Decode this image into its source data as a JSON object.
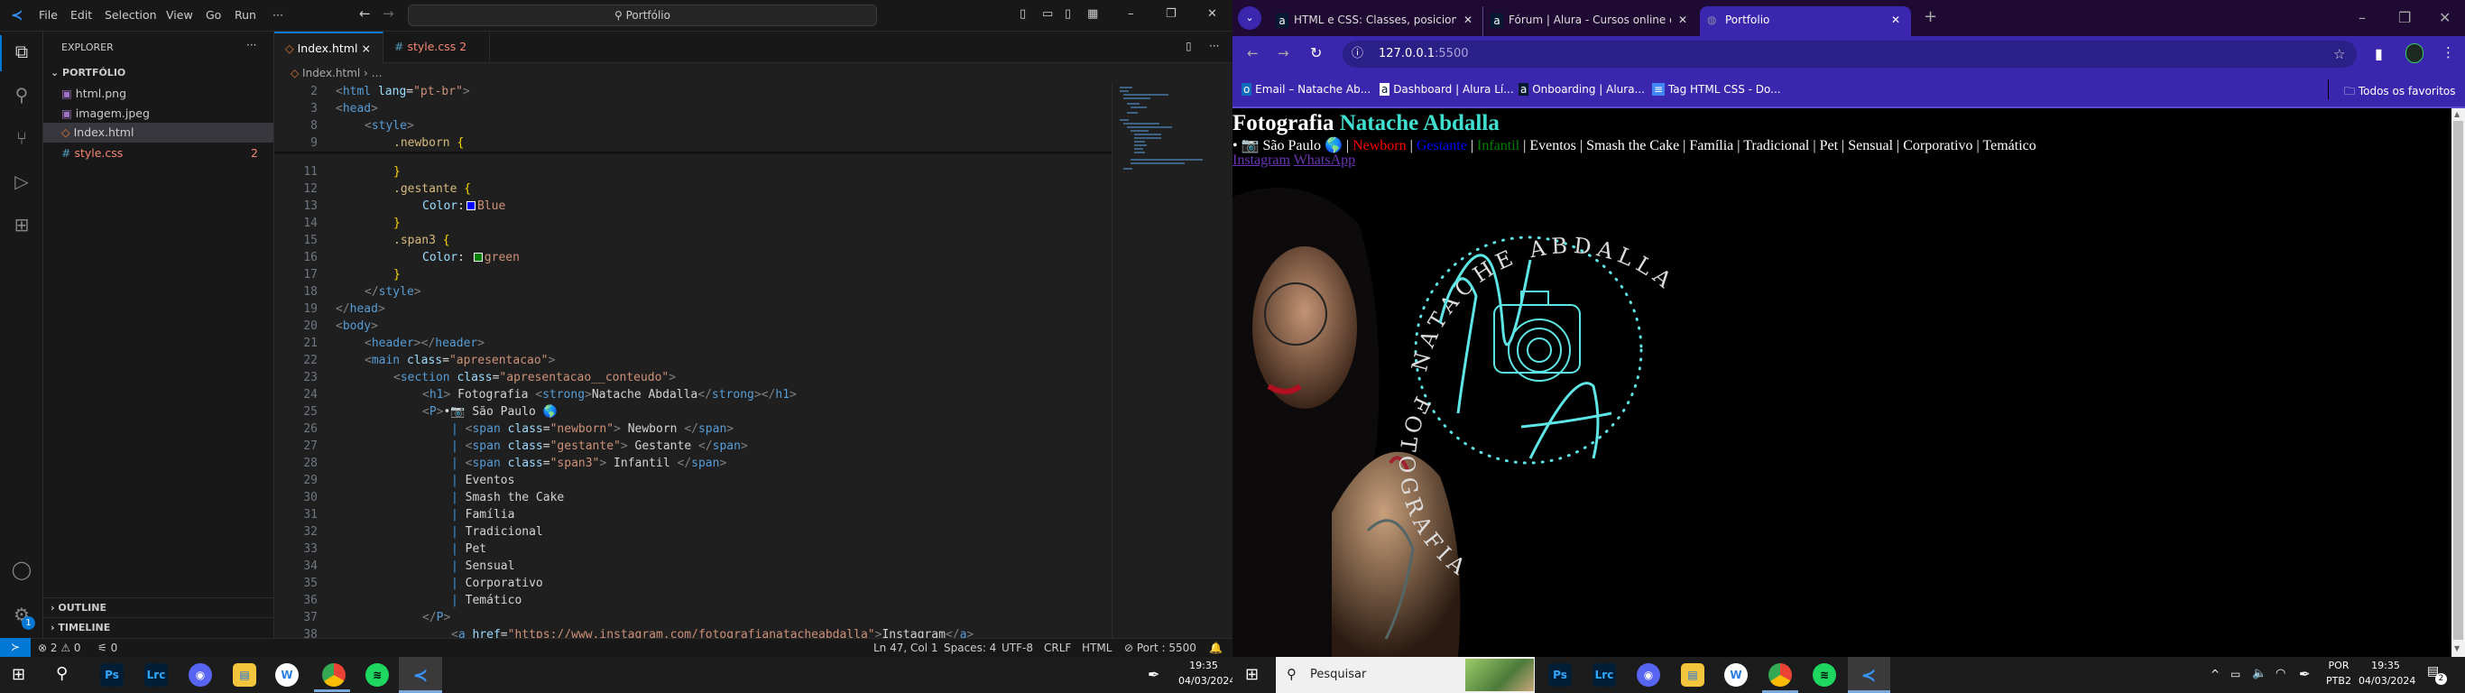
{
  "vscode": {
    "menu": [
      "File",
      "Edit",
      "Selection",
      "View",
      "Go",
      "Run",
      "···"
    ],
    "command_center": "Portfólio",
    "explorer_title": "EXPLORER",
    "more": "···",
    "folder": "PORTFÓLIO",
    "files": [
      {
        "name": "html.png",
        "icon": "image-icon",
        "color": "#a074c4"
      },
      {
        "name": "imagem.jpeg",
        "icon": "image-icon",
        "color": "#a074c4"
      },
      {
        "name": "Index.html",
        "icon": "html-icon",
        "color": "#e37933",
        "selected": true
      },
      {
        "name": "style.css",
        "icon": "css-icon",
        "color": "#519aba",
        "badge": "2",
        "error": true
      }
    ],
    "outline": "OUTLINE",
    "timeline": "TIMELINE",
    "settings_badge": "1",
    "tabs": [
      {
        "label": "Index.html",
        "active": true,
        "close": "×"
      },
      {
        "label": "style.css",
        "badge": "2"
      }
    ],
    "breadcrumb": [
      "Index.html",
      "…"
    ],
    "lines": [
      {
        "n": 2,
        "i": 0,
        "sticky": true,
        "tk": [
          [
            "p",
            "<"
          ],
          [
            "t",
            "html"
          ],
          [
            "a",
            " lang"
          ],
          [
            "x",
            "="
          ],
          [
            "s",
            "\"pt-br\""
          ],
          [
            "p",
            ">"
          ]
        ]
      },
      {
        "n": 3,
        "i": 0,
        "sticky": true,
        "tk": [
          [
            "p",
            "<"
          ],
          [
            "t",
            "head"
          ],
          [
            "p",
            ">"
          ]
        ]
      },
      {
        "n": 8,
        "i": 1,
        "sticky": true,
        "tk": [
          [
            "p",
            "<"
          ],
          [
            "t",
            "style"
          ],
          [
            "p",
            ">"
          ]
        ]
      },
      {
        "n": 9,
        "i": 2,
        "sticky": true,
        "tk": [
          [
            "c",
            ".newborn "
          ],
          [
            "b",
            "{"
          ]
        ]
      },
      {
        "n": 11,
        "i": 2,
        "tk": [
          [
            "b",
            "}"
          ]
        ]
      },
      {
        "n": 12,
        "i": 2,
        "tk": [
          [
            "c",
            ".gestante "
          ],
          [
            "b",
            "{"
          ]
        ]
      },
      {
        "n": 13,
        "i": 3,
        "tk": [
          [
            "k",
            "Color"
          ],
          [
            "x",
            ":"
          ],
          [
            "sw",
            "#0000ff"
          ],
          [
            "v",
            "Blue"
          ]
        ]
      },
      {
        "n": 14,
        "i": 2,
        "tk": [
          [
            "b",
            "}"
          ]
        ]
      },
      {
        "n": 15,
        "i": 2,
        "tk": [
          [
            "c",
            ".span3 "
          ],
          [
            "b",
            "{"
          ]
        ]
      },
      {
        "n": 16,
        "i": 3,
        "tk": [
          [
            "k",
            "Color"
          ],
          [
            "x",
            ": "
          ],
          [
            "sw",
            "#008000"
          ],
          [
            "v",
            "green"
          ]
        ]
      },
      {
        "n": 17,
        "i": 2,
        "tk": [
          [
            "b",
            "}"
          ]
        ]
      },
      {
        "n": 18,
        "i": 1,
        "tk": [
          [
            "p",
            "</"
          ],
          [
            "t",
            "style"
          ],
          [
            "p",
            ">"
          ]
        ]
      },
      {
        "n": 19,
        "i": 0,
        "tk": [
          [
            "p",
            "</"
          ],
          [
            "t",
            "head"
          ],
          [
            "p",
            ">"
          ]
        ]
      },
      {
        "n": 20,
        "i": 0,
        "tk": [
          [
            "p",
            "<"
          ],
          [
            "t",
            "body"
          ],
          [
            "p",
            ">"
          ]
        ]
      },
      {
        "n": 21,
        "i": 1,
        "tk": [
          [
            "p",
            "<"
          ],
          [
            "t",
            "header"
          ],
          [
            "p",
            "></"
          ],
          [
            "t",
            "header"
          ],
          [
            "p",
            ">"
          ]
        ]
      },
      {
        "n": 22,
        "i": 1,
        "tk": [
          [
            "p",
            "<"
          ],
          [
            "t",
            "main"
          ],
          [
            "a",
            " class"
          ],
          [
            "x",
            "="
          ],
          [
            "s",
            "\"apresentacao\""
          ],
          [
            "p",
            ">"
          ]
        ]
      },
      {
        "n": 23,
        "i": 2,
        "tk": [
          [
            "p",
            "<"
          ],
          [
            "t",
            "section"
          ],
          [
            "a",
            " class"
          ],
          [
            "x",
            "="
          ],
          [
            "s",
            "\"apresentacao__conteudo\""
          ],
          [
            "p",
            ">"
          ]
        ]
      },
      {
        "n": 24,
        "i": 3,
        "tk": [
          [
            "p",
            "<"
          ],
          [
            "t",
            "h1"
          ],
          [
            "p",
            ">"
          ],
          [
            "x",
            " Fotografia "
          ],
          [
            "p",
            "<"
          ],
          [
            "t",
            "strong"
          ],
          [
            "p",
            ">"
          ],
          [
            "x",
            "Natache Abdalla"
          ],
          [
            "p",
            "</"
          ],
          [
            "t",
            "strong"
          ],
          [
            "p",
            "></"
          ],
          [
            "t",
            "h1"
          ],
          [
            "p",
            ">"
          ]
        ]
      },
      {
        "n": 25,
        "i": 3,
        "tk": [
          [
            "p",
            "<"
          ],
          [
            "t",
            "P"
          ],
          [
            "p",
            ">"
          ],
          [
            "x",
            "•📷 São Paulo 🌎"
          ]
        ]
      },
      {
        "n": 26,
        "i": 4,
        "tk": [
          [
            "g",
            "| "
          ],
          [
            "p",
            "<"
          ],
          [
            "t",
            "span"
          ],
          [
            "a",
            " class"
          ],
          [
            "x",
            "="
          ],
          [
            "s",
            "\"newborn\""
          ],
          [
            "p",
            ">"
          ],
          [
            "x",
            " Newborn "
          ],
          [
            "p",
            "</"
          ],
          [
            "t",
            "span"
          ],
          [
            "p",
            ">"
          ]
        ]
      },
      {
        "n": 27,
        "i": 4,
        "tk": [
          [
            "g",
            "| "
          ],
          [
            "p",
            "<"
          ],
          [
            "t",
            "span"
          ],
          [
            "a",
            " class"
          ],
          [
            "x",
            "="
          ],
          [
            "s",
            "\"gestante\""
          ],
          [
            "p",
            ">"
          ],
          [
            "x",
            " Gestante "
          ],
          [
            "p",
            "</"
          ],
          [
            "t",
            "span"
          ],
          [
            "p",
            ">"
          ]
        ]
      },
      {
        "n": 28,
        "i": 4,
        "tk": [
          [
            "g",
            "| "
          ],
          [
            "p",
            "<"
          ],
          [
            "t",
            "span"
          ],
          [
            "a",
            " class"
          ],
          [
            "x",
            "="
          ],
          [
            "s",
            "\"span3\""
          ],
          [
            "p",
            ">"
          ],
          [
            "x",
            " Infantil "
          ],
          [
            "p",
            "</"
          ],
          [
            "t",
            "span"
          ],
          [
            "p",
            ">"
          ]
        ]
      },
      {
        "n": 29,
        "i": 4,
        "tk": [
          [
            "g",
            "| "
          ],
          [
            "x",
            "Eventos"
          ]
        ]
      },
      {
        "n": 30,
        "i": 4,
        "tk": [
          [
            "g",
            "| "
          ],
          [
            "x",
            "Smash the Cake"
          ]
        ]
      },
      {
        "n": 31,
        "i": 4,
        "tk": [
          [
            "g",
            "| "
          ],
          [
            "x",
            "Família"
          ]
        ]
      },
      {
        "n": 32,
        "i": 4,
        "tk": [
          [
            "g",
            "| "
          ],
          [
            "x",
            "Tradicional"
          ]
        ]
      },
      {
        "n": 33,
        "i": 4,
        "tk": [
          [
            "g",
            "| "
          ],
          [
            "x",
            "Pet"
          ]
        ]
      },
      {
        "n": 34,
        "i": 4,
        "tk": [
          [
            "g",
            "| "
          ],
          [
            "x",
            "Sensual"
          ]
        ]
      },
      {
        "n": 35,
        "i": 4,
        "tk": [
          [
            "g",
            "| "
          ],
          [
            "x",
            "Corporativo"
          ]
        ]
      },
      {
        "n": 36,
        "i": 4,
        "tk": [
          [
            "g",
            "| "
          ],
          [
            "x",
            "Temático"
          ]
        ]
      },
      {
        "n": 37,
        "i": 3,
        "tk": [
          [
            "p",
            "</"
          ],
          [
            "t",
            "P"
          ],
          [
            "p",
            ">"
          ]
        ]
      },
      {
        "n": 38,
        "i": 4,
        "tk": [
          [
            "p",
            "<"
          ],
          [
            "t",
            "a"
          ],
          [
            "a",
            " href"
          ],
          [
            "x",
            "="
          ],
          [
            "u",
            "\"https://www.instagram.com/fotografianatacheabdalla\""
          ],
          [
            "p",
            ">"
          ],
          [
            "x",
            "Instagram"
          ],
          [
            "p",
            "</"
          ],
          [
            "t",
            "a"
          ],
          [
            "p",
            ">"
          ]
        ]
      }
    ],
    "status": {
      "errors": "2",
      "warnings": "0",
      "ports": "0",
      "position": "Ln 47, Col 1",
      "spaces": "Spaces: 4",
      "encoding": "UTF-8",
      "eol": "CRLF",
      "language": "HTML",
      "port": "Port : 5500"
    }
  },
  "browser": {
    "tabs": [
      {
        "title": "HTML e CSS: Classes, posicionar",
        "icon": "alura-icon"
      },
      {
        "title": "Fórum | Alura - Cursos online d",
        "icon": "alura-icon"
      },
      {
        "title": "Portfolio",
        "icon": "globe-icon",
        "active": true
      }
    ],
    "new_tab": "+",
    "url_host": "127.0.0.1",
    "url_port": ":5500",
    "bookmarks": [
      "Email – Natache Ab...",
      "Dashboard | Alura Lí...",
      "Onboarding | Alura...",
      "Tag HTML CSS - Do..."
    ],
    "all_bookmarks": "Todos os favoritos",
    "page": {
      "h1_plain": "Fotografia",
      "h1_strong": "Natache Abdalla",
      "h1_strong_color": "#40e0d0",
      "location": "• 📷 São Paulo 🌎",
      "services": [
        {
          "label": "Newborn",
          "color": "#ff0000"
        },
        {
          "label": "Gestante",
          "color": "#0000ff"
        },
        {
          "label": "Infantil",
          "color": "#008000"
        },
        {
          "label": "Eventos"
        },
        {
          "label": "Smash the Cake"
        },
        {
          "label": "Família"
        },
        {
          "label": "Tradicional"
        },
        {
          "label": "Pet"
        },
        {
          "label": "Sensual"
        },
        {
          "label": "Corporativo"
        },
        {
          "label": "Temático"
        }
      ],
      "links": [
        "Instagram",
        "WhatsApp"
      ],
      "logo_top": "NATACHE ABDALLA",
      "logo_bottom": "FOTOGRAFIA",
      "logo_color": "#5ee6e6"
    }
  },
  "taskbar_left": {
    "time": "19:35",
    "date": "04/03/2024"
  },
  "taskbar_right": {
    "search_placeholder": "Pesquisar",
    "lang1": "POR",
    "lang2": "PTB2",
    "time": "19:35",
    "date": "04/03/2024",
    "notifications": "2"
  },
  "taskbar_apps": [
    "Ps",
    "Lrc",
    "Discord",
    "Files",
    "W",
    "Chrome",
    "Spotify",
    "VS Code"
  ]
}
